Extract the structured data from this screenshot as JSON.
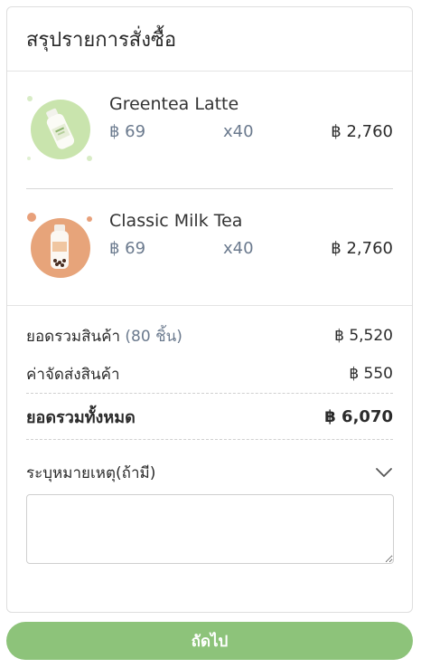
{
  "header": {
    "title": "สรุปรายการสั่งซื้อ"
  },
  "items": [
    {
      "name": "Greentea Latte",
      "price": "฿ 69",
      "qty": "x40",
      "total": "฿ 2,760",
      "thumb_color": "#c9e4ad",
      "icon": "greentea-bottle-icon"
    },
    {
      "name": "Classic Milk Tea",
      "price": "฿ 69",
      "qty": "x40",
      "total": "฿ 2,760",
      "thumb_color": "#e7a47a",
      "icon": "milktea-bottle-icon"
    }
  ],
  "summary": {
    "subtotal_label": "ยอดรวมสินค้า",
    "subtotal_count": "(80 ชิ้น)",
    "subtotal_value": "฿ 5,520",
    "shipping_label": "ค่าจัดส่งสินค้า",
    "shipping_value": "฿ 550",
    "grand_label": "ยอดรวมทั้งหมด",
    "grand_value": "฿ 6,070"
  },
  "note": {
    "label": "ระบุหมายเหตุ(ถ้ามี)",
    "value": ""
  },
  "actions": {
    "next_label": "ถัดไป"
  },
  "colors": {
    "accent": "#8dc37a",
    "muted_text": "#6b7a8e"
  }
}
